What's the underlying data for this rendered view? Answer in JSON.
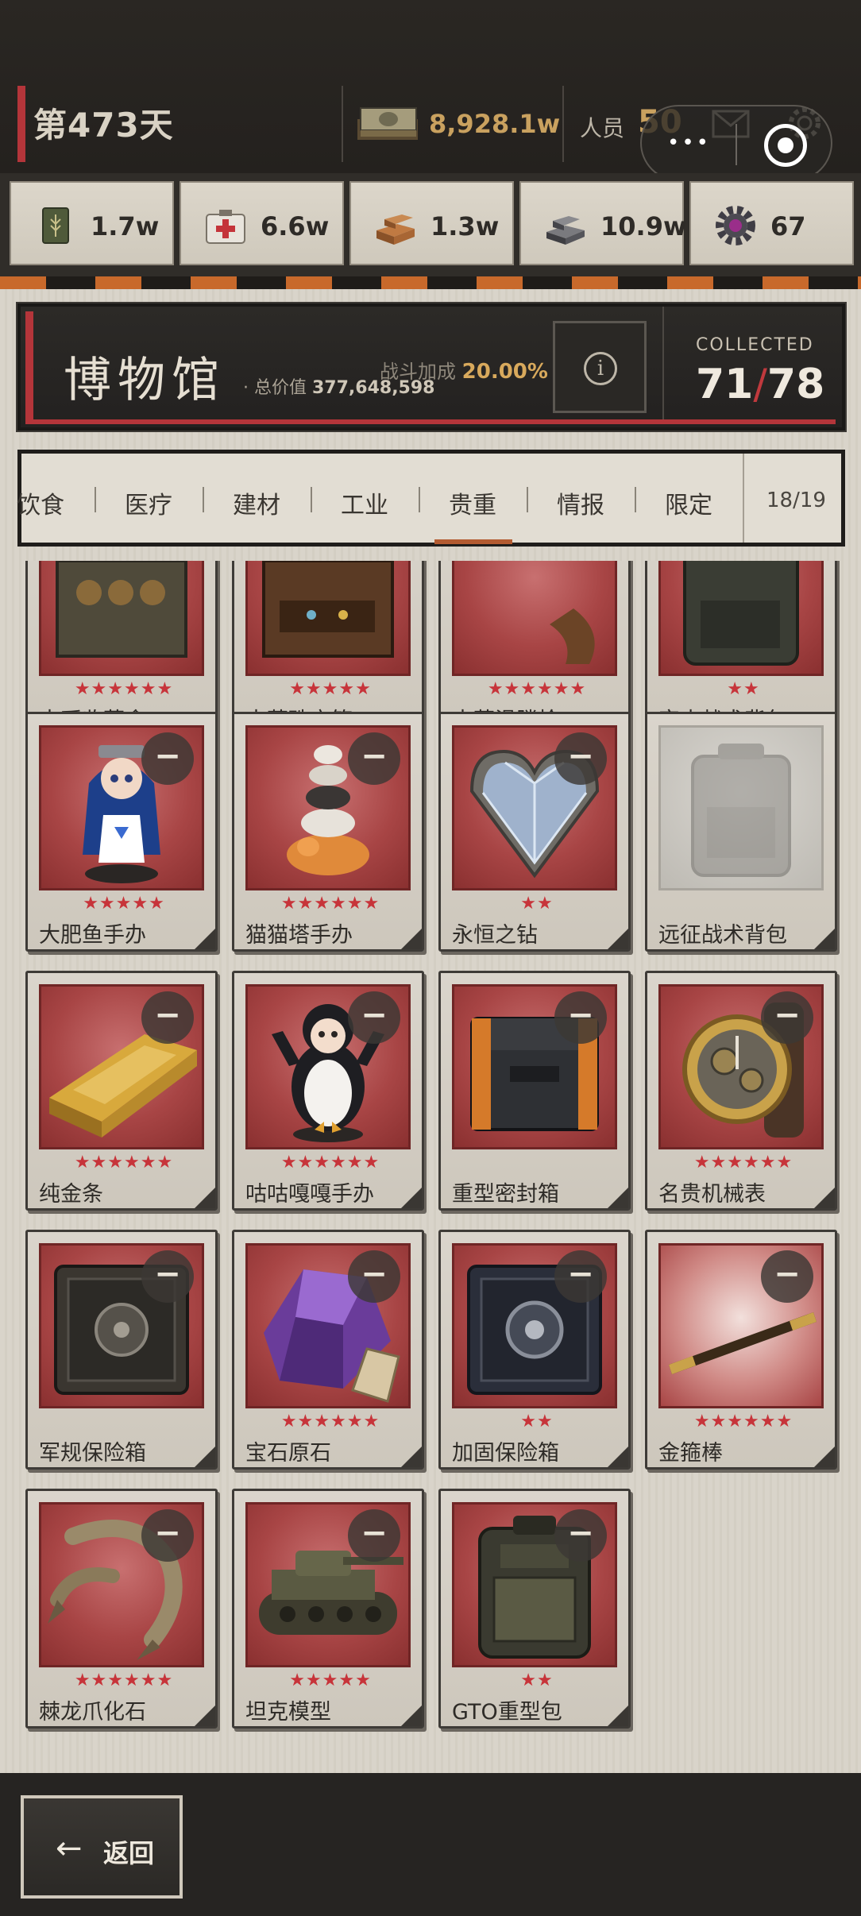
{
  "topbar": {
    "day": "第473天",
    "cash": "8,928.1w",
    "staff_label": "人员",
    "staff_value": "50",
    "mail_icon": "mail-icon",
    "settings_icon": "gear-icon",
    "capsule_dots": "•••"
  },
  "resources": [
    {
      "icon": "food-can-icon",
      "value": "1.7w"
    },
    {
      "icon": "medkit-icon",
      "value": "6.6w"
    },
    {
      "icon": "bricks-icon",
      "value": "1.3w"
    },
    {
      "icon": "steel-ingot-icon",
      "value": "10.9w"
    },
    {
      "icon": "gear-part-icon",
      "value": "67"
    }
  ],
  "museum": {
    "title": "博物馆",
    "total_prefix": "· 总价值",
    "total_value": "377,648,598",
    "bonus_label": "战斗加成",
    "bonus_value": "20.00%",
    "info_symbol": "i",
    "collected_label": "COLLECTED",
    "collected": "71",
    "slash": "/",
    "total": "78"
  },
  "tabs": {
    "items": [
      "饮食",
      "医疗",
      "建材",
      "工业",
      "贵重",
      "情报",
      "限定"
    ],
    "active": "贵重",
    "count": "18/19"
  },
  "items": [
    {
      "name": "古币收藏盒",
      "stars": "★★★★★★",
      "art": "coin-box"
    },
    {
      "name": "古董珠宝箱",
      "stars": "★★★★★",
      "art": "jewel-chest"
    },
    {
      "name": "古董滑膛枪",
      "stars": "★★★★★★",
      "art": "musket"
    },
    {
      "name": "突击战术背包",
      "stars": "★★",
      "art": "backpack"
    },
    {
      "name": "大肥鱼手办",
      "stars": "★★★★★",
      "art": "figure-girl"
    },
    {
      "name": "猫猫塔手办",
      "stars": "★★★★★★",
      "art": "cat-tower"
    },
    {
      "name": "永恒之钻",
      "stars": "★★",
      "art": "diamond"
    },
    {
      "name": "远征战术背包",
      "stars": "",
      "art": "backpack-locked"
    },
    {
      "name": "纯金条",
      "stars": "★★★★★★",
      "art": "gold-bar"
    },
    {
      "name": "咕咕嘎嘎手办",
      "stars": "★★★★★★",
      "art": "penguin"
    },
    {
      "name": "重型密封箱",
      "stars": "",
      "art": "heavy-case"
    },
    {
      "name": "名贵机械表",
      "stars": "★★★★★★",
      "art": "watch"
    },
    {
      "name": "军规保险箱",
      "stars": "",
      "art": "safe"
    },
    {
      "name": "宝石原石",
      "stars": "★★★★★★",
      "art": "gem-rock"
    },
    {
      "name": "加固保险箱",
      "stars": "★★",
      "art": "safe-dark"
    },
    {
      "name": "金箍棒",
      "stars": "★★★★★★",
      "art": "staff"
    },
    {
      "name": "棘龙爪化石",
      "stars": "★★★★★★",
      "art": "claw"
    },
    {
      "name": "坦克模型",
      "stars": "★★★★★",
      "art": "tank"
    },
    {
      "name": "GTO重型包",
      "stars": "★★",
      "art": "backpack-big"
    }
  ],
  "item_action_symbol": "−",
  "bottom": {
    "back_arrow": "←",
    "back_label": "返回"
  },
  "colors": {
    "accent_red": "#b4353a",
    "gold": "#c9a15f",
    "card_red": "#a84545",
    "tab_active": "#b35b31"
  }
}
